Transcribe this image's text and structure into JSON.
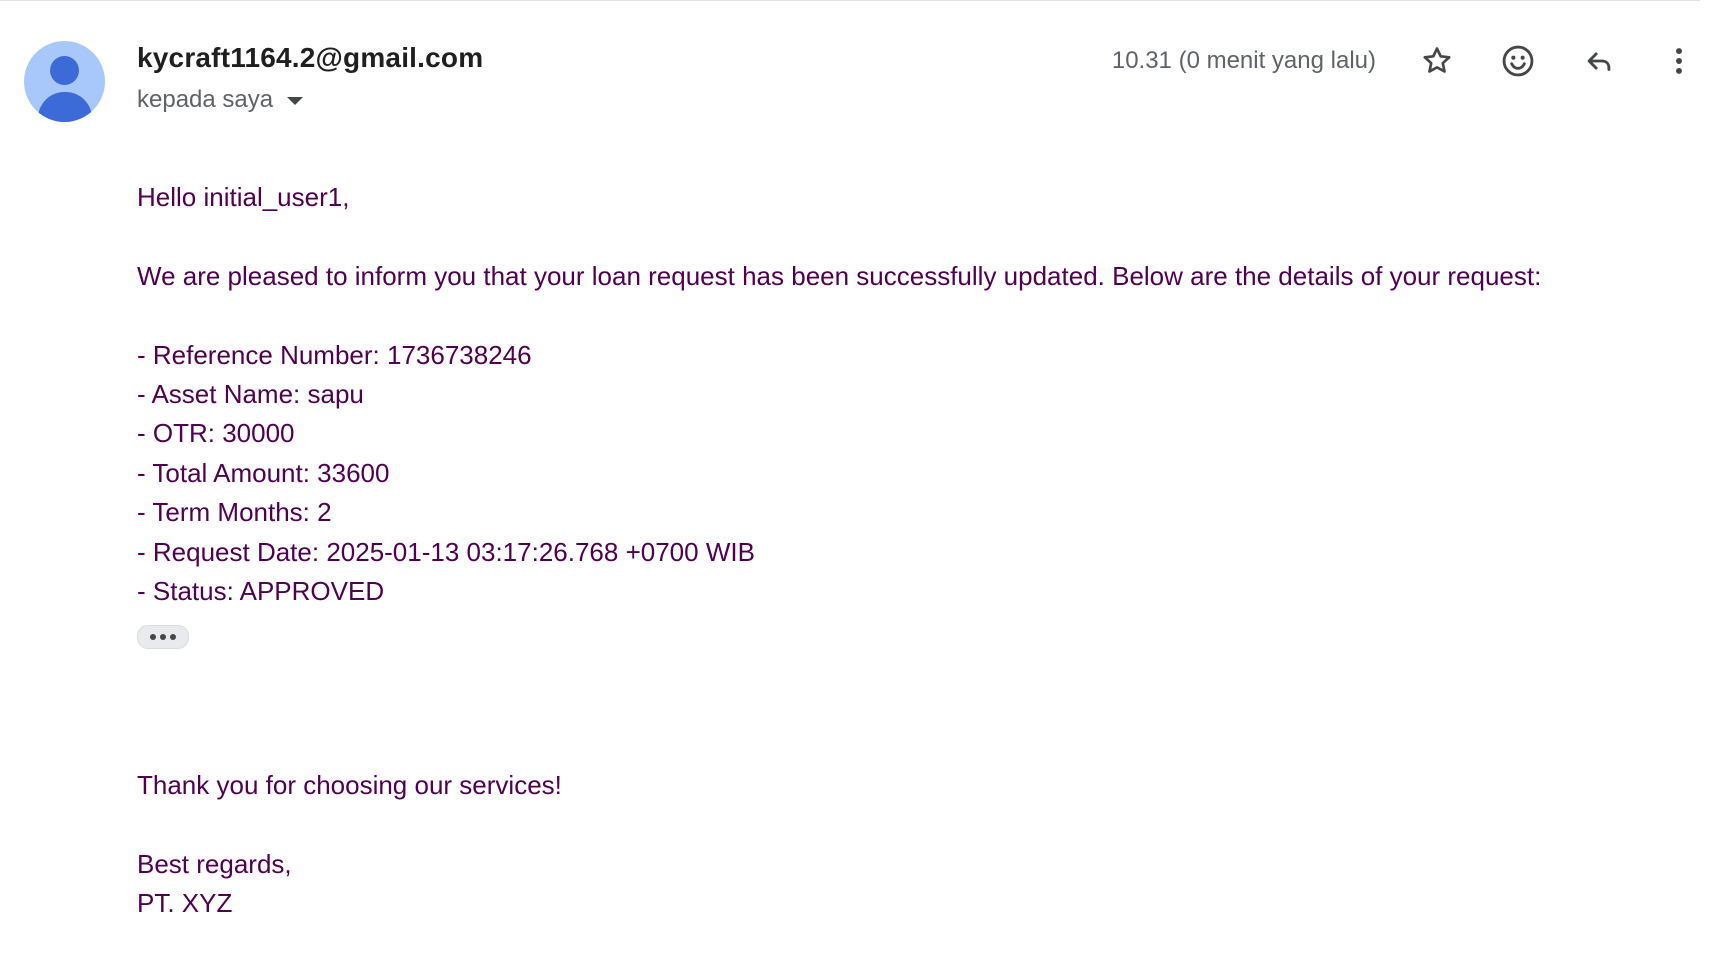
{
  "header": {
    "sender_email": "kycraft1164.2@gmail.com",
    "recipient_label": "kepada saya",
    "timestamp": "10.31 (0 menit yang lalu)",
    "icons": {
      "avatar": "person-avatar-icon",
      "star": "star-icon",
      "emoji": "emoji-reaction-icon",
      "reply": "reply-icon",
      "more": "more-vert-icon",
      "recipient_toggle": "caret-down-icon"
    }
  },
  "message": {
    "greeting": "Hello initial_user1,",
    "intro": "We are pleased to inform you that your loan request has been successfully updated. Below are the details of your request:",
    "details": [
      "- Reference Number: 1736738246",
      "- Asset Name: sapu",
      "- OTR: 30000",
      "- Total Amount: 33600",
      "- Term Months: 2",
      "- Request Date: 2025-01-13 03:17:26.768 +0700 WIB",
      "- Status: APPROVED"
    ],
    "closing_thanks": "Thank you for choosing our services!",
    "sign_off": "Best regards,",
    "signature": "PT. XYZ"
  },
  "colors": {
    "body_text": "#500050",
    "sender_text": "#1f1f1f",
    "muted_text": "#5f6368",
    "avatar_bg": "#a8c7fa",
    "avatar_fg": "#3c6ad7"
  }
}
